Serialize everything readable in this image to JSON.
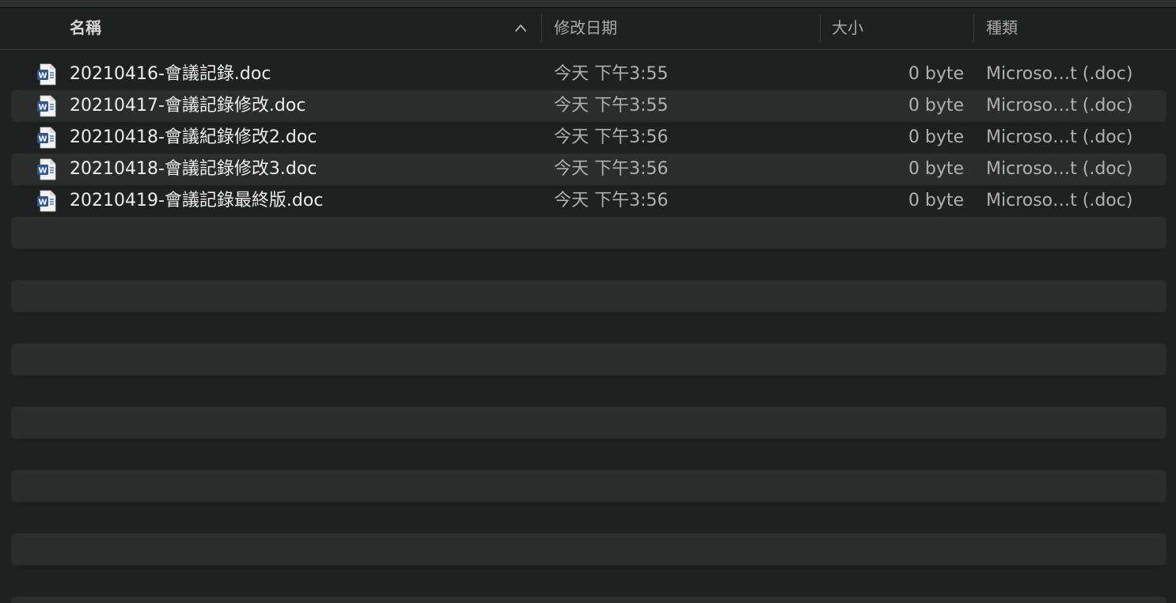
{
  "columns": {
    "name": "名稱",
    "date": "修改日期",
    "size": "大小",
    "kind": "種類"
  },
  "icons": {
    "sort": "chevron-up-icon",
    "file": "word-doc-icon"
  },
  "colors": {
    "word_blue": "#2b579a"
  },
  "files": [
    {
      "name": "20210416-會議記錄.doc",
      "date": "今天 下午3:55",
      "size": "0 byte",
      "kind": "Microso…t (.doc)"
    },
    {
      "name": "20210417-會議記錄修改.doc",
      "date": "今天 下午3:55",
      "size": "0 byte",
      "kind": "Microso…t (.doc)"
    },
    {
      "name": "20210418-會議紀錄修改2.doc",
      "date": "今天 下午3:56",
      "size": "0 byte",
      "kind": "Microso…t (.doc)"
    },
    {
      "name": "20210418-會議記錄修改3.doc",
      "date": "今天 下午3:56",
      "size": "0 byte",
      "kind": "Microso…t (.doc)"
    },
    {
      "name": "20210419-會議記錄最終版.doc",
      "date": "今天 下午3:56",
      "size": "0 byte",
      "kind": "Microso…t (.doc)"
    }
  ]
}
